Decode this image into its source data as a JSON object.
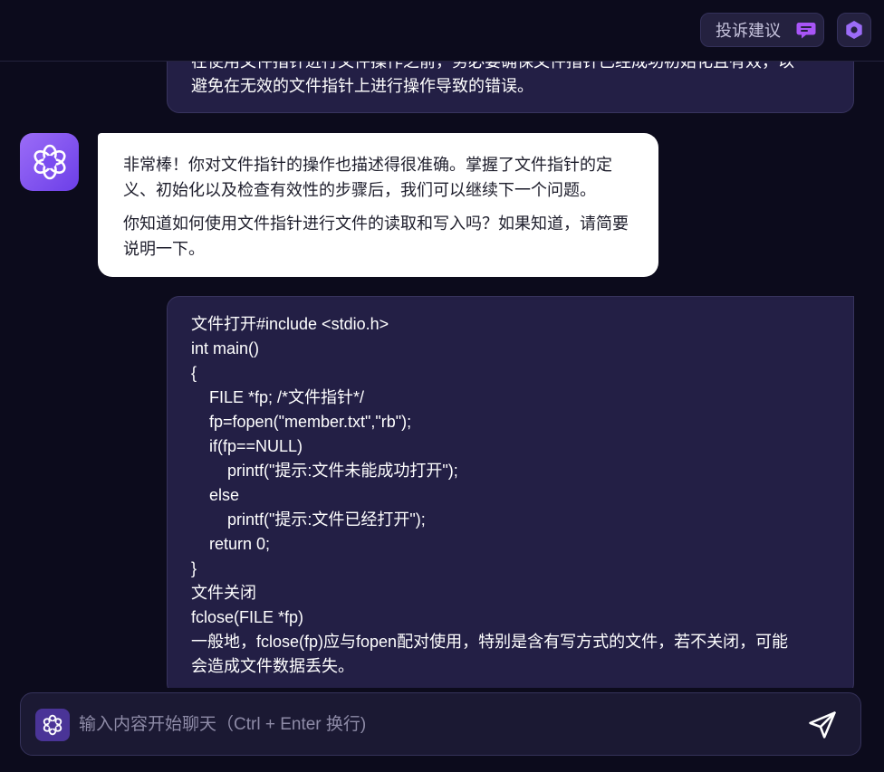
{
  "header": {
    "complaint_label": "投诉建议"
  },
  "messages": {
    "user_first_text": "在使用文件指针进行文件操作之前，务必要确保文件指针已经成功初始化且有效，以\n避免在无效的文件指针上进行操作导致的错误。",
    "bot_para1": "非常棒！你对文件指针的操作也描述得很准确。掌握了文件指针的定义、初始化以及检查有效性的步骤后，我们可以继续下一个问题。",
    "bot_para2": "你知道如何使用文件指针进行文件的读取和写入吗？如果知道，请简要说明一下。",
    "user_second_text": "文件打开#include <stdio.h>\nint main()\n{\n    FILE *fp; /*文件指针*/\n    fp=fopen(\"member.txt\",\"rb\");\n    if(fp==NULL)\n        printf(\"提示:文件未能成功打开\");\n    else\n        printf(\"提示:文件已经打开\");\n    return 0;\n}\n文件关闭\nfclose(FILE *fp)\n一般地，fclose(fp)应与fopen配对使用，特别是含有写方式的文件，若不关闭，可能\n会造成文件数据丢失。"
  },
  "input": {
    "placeholder": "输入内容开始聊天（Ctrl + Enter 换行)",
    "value": ""
  },
  "icons": {
    "complaint": "chat-bubble-icon",
    "settings": "hexagon-settings-icon",
    "bot": "flower-logo-icon",
    "send": "paper-plane-icon"
  },
  "colors": {
    "accent": "#8b5cf6",
    "background": "#0c0b1c",
    "user_bubble": "#231f45",
    "bot_bubble": "#ffffff"
  }
}
